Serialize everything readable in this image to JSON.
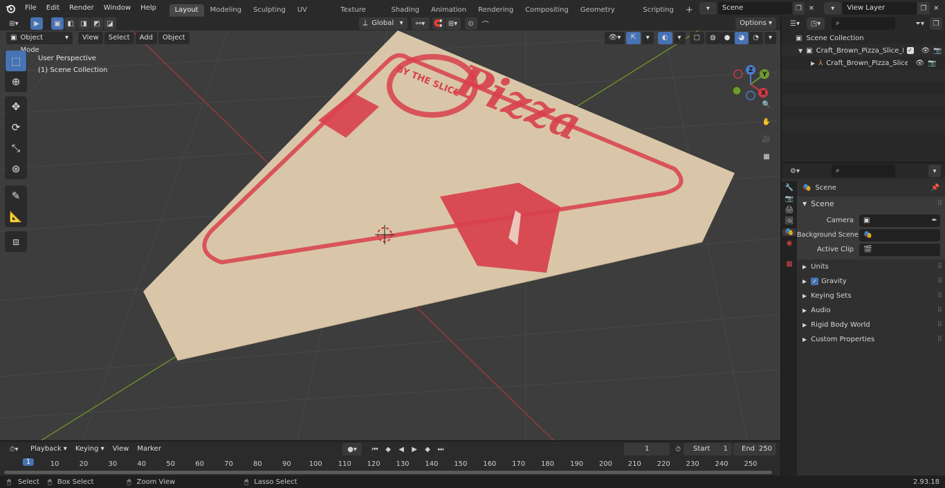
{
  "menu": [
    "File",
    "Edit",
    "Render",
    "Window",
    "Help"
  ],
  "workspaces": [
    {
      "label": "Layout",
      "active": true
    },
    {
      "label": "Modeling"
    },
    {
      "label": "Sculpting"
    },
    {
      "label": "UV Editing"
    },
    {
      "label": "Texture Paint"
    },
    {
      "label": "Shading"
    },
    {
      "label": "Animation"
    },
    {
      "label": "Rendering"
    },
    {
      "label": "Compositing"
    },
    {
      "label": "Geometry Nodes"
    },
    {
      "label": "Scripting"
    }
  ],
  "scene_field": "Scene",
  "view_layer_field": "View Layer",
  "viewport": {
    "mode": "Object Mode",
    "menus": [
      "View",
      "Select",
      "Add",
      "Object"
    ],
    "transform_orientation": "Global",
    "options_label": "Options",
    "overlay_line1": "User Perspective",
    "overlay_line2": "(1) Scene Collection"
  },
  "outliner": {
    "root": "Scene Collection",
    "items": [
      {
        "label": "Craft_Brown_Pizza_Slice_Pack"
      },
      {
        "label": "Craft_Brown_Pizza_Slice_"
      }
    ]
  },
  "properties": {
    "context_label": "Scene",
    "section_title": "Scene",
    "rows": [
      {
        "label": "Camera"
      },
      {
        "label": "Background Scene"
      },
      {
        "label": "Active Clip"
      }
    ],
    "panels": [
      "Units",
      "Gravity",
      "Keying Sets",
      "Audio",
      "Rigid Body World",
      "Custom Properties"
    ],
    "gravity_checked": true
  },
  "timeline": {
    "menus": [
      "Playback",
      "Keying",
      "View",
      "Marker"
    ],
    "current_frame": "1",
    "start_label": "Start",
    "start_value": "1",
    "end_label": "End",
    "end_value": "250",
    "ruler_ticks": [
      "1",
      "10",
      "20",
      "30",
      "40",
      "50",
      "60",
      "70",
      "80",
      "90",
      "100",
      "110",
      "120",
      "130",
      "140",
      "150",
      "160",
      "170",
      "180",
      "190",
      "200",
      "210",
      "220",
      "230",
      "240",
      "250"
    ]
  },
  "status": {
    "select": "Select",
    "box_select": "Box Select",
    "zoom_view": "Zoom View",
    "lasso_select": "Lasso Select",
    "version": "2.93.18"
  },
  "pizza_texture": {
    "brand_text": "Pizza",
    "arc_text": "BY THE SLICE"
  },
  "colors": {
    "accent": "#4772b3",
    "box_color": "#d9c6a8",
    "print_red": "#d8404c"
  }
}
